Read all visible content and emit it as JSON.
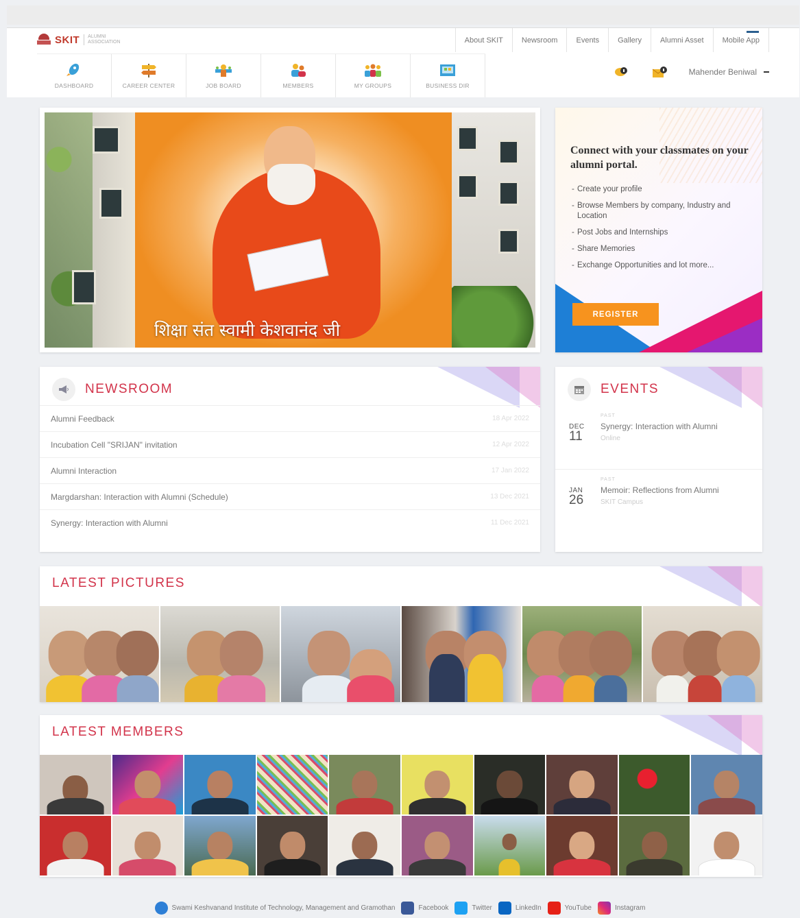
{
  "brand": {
    "name": "SKIT",
    "tagline": "ALUMNI ASSOCIATION"
  },
  "topnav": [
    "About SKIT",
    "Newsroom",
    "Events",
    "Gallery",
    "Alumni Asset",
    "Mobile App"
  ],
  "mainnav": [
    {
      "label": "DASHBOARD",
      "icon": "rocket-icon"
    },
    {
      "label": "CAREER CENTER",
      "icon": "signpost-icon"
    },
    {
      "label": "JOB BOARD",
      "icon": "job-board-icon"
    },
    {
      "label": "MEMBERS",
      "icon": "members-icon"
    },
    {
      "label": "MY GROUPS",
      "icon": "groups-icon"
    },
    {
      "label": "BUSINESS DIR",
      "icon": "business-directory-icon"
    }
  ],
  "user": {
    "name": "Mahender Beniwal"
  },
  "hero": {
    "caption": "शिक्षा संत स्वामी केशवानंद जी"
  },
  "promo": {
    "title": "Connect with your classmates on your alumni portal.",
    "items": [
      "Create your profile",
      "Browse Members by company, Industry and Location",
      "Post Jobs and Internships",
      "Share Memories",
      "Exchange Opportunities and lot more..."
    ],
    "button": "REGISTER"
  },
  "newsroom": {
    "title": "NEWSROOM",
    "items": [
      {
        "title": "Alumni Feedback",
        "date": "18 Apr 2022"
      },
      {
        "title": "Incubation Cell \"SRIJAN\" invitation",
        "date": "12 Apr 2022"
      },
      {
        "title": "Alumni Interaction",
        "date": "17 Jan 2022"
      },
      {
        "title": "Margdarshan: Interaction with Alumni (Schedule)",
        "date": "13 Dec 2021"
      },
      {
        "title": "Synergy: Interaction with Alumni",
        "date": "11 Dec 2021"
      }
    ]
  },
  "events": {
    "title": "EVENTS",
    "items": [
      {
        "status": "PAST",
        "month": "DEC",
        "day": "11",
        "title": "Synergy: Interaction with Alumni",
        "location": "Online"
      },
      {
        "status": "PAST",
        "month": "JAN",
        "day": "26",
        "title": "Memoir: Reflections from Alumni",
        "location": "SKIT Campus"
      }
    ]
  },
  "pictures": {
    "title": "LATEST PICTURES"
  },
  "members": {
    "title": "LATEST MEMBERS"
  },
  "footer": {
    "institute": "Swami Keshvanand Institute of Technology, Management and Gramothan",
    "links": [
      "Facebook",
      "Twitter",
      "LinkedIn",
      "YouTube",
      "Instagram"
    ]
  },
  "colors": {
    "accent": "#d2334a",
    "register": "#f7931e",
    "facebook": "#3b5998",
    "twitter": "#1da1f2",
    "linkedin": "#0a66c2",
    "youtube": "#e62117",
    "instagram": "#c13584"
  }
}
